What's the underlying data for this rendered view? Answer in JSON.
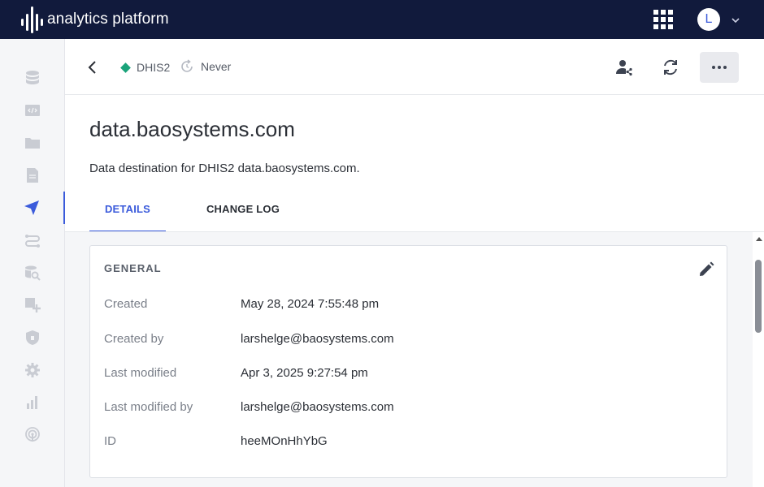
{
  "app": {
    "title": "analytics platform",
    "user_initial": "L"
  },
  "sidebar": {
    "items": [
      {
        "icon": "database-icon",
        "active": false
      },
      {
        "icon": "code-icon",
        "active": false
      },
      {
        "icon": "folder-icon",
        "active": false
      },
      {
        "icon": "document-icon",
        "active": false
      },
      {
        "icon": "send-icon",
        "active": true
      },
      {
        "icon": "pipeline-icon",
        "active": false
      },
      {
        "icon": "data-search-icon",
        "active": false
      },
      {
        "icon": "add-widget-icon",
        "active": false
      },
      {
        "icon": "shield-icon",
        "active": false
      },
      {
        "icon": "gear-icon",
        "active": false
      },
      {
        "icon": "bar-chart-icon",
        "active": false
      },
      {
        "icon": "broadcast-icon",
        "active": false
      }
    ]
  },
  "header": {
    "type": "DHIS2",
    "sync_status": "Never"
  },
  "page": {
    "title": "data.baosystems.com",
    "description": "Data destination for DHIS2 data.baosystems.com."
  },
  "tabs": [
    {
      "label": "DETAILS",
      "active": true
    },
    {
      "label": "CHANGE LOG",
      "active": false
    }
  ],
  "general": {
    "title": "GENERAL",
    "rows": [
      {
        "label": "Created",
        "value": "May 28, 2024 7:55:48 pm"
      },
      {
        "label": "Created by",
        "value": "larshelge@baosystems.com"
      },
      {
        "label": "Last modified",
        "value": "Apr 3, 2025 9:27:54 pm"
      },
      {
        "label": "Last modified by",
        "value": "larshelge@baosystems.com"
      },
      {
        "label": "ID",
        "value": "heeMOnHhYbG"
      }
    ]
  },
  "colors": {
    "topbar": "#111a3c",
    "accent": "#3b5bdb",
    "status_green": "#1aa37a"
  }
}
